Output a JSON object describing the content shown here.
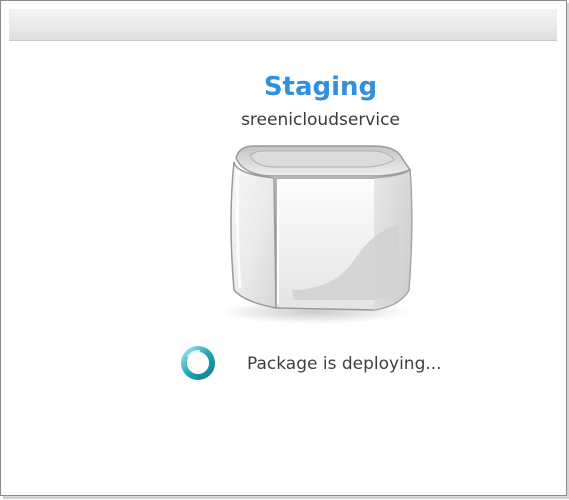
{
  "deployment": {
    "environment": "Staging",
    "service_name": "sreenicloudservice",
    "status_text": "Package is deploying...",
    "cube_icon": "cloud-service-cube-icon",
    "spinner_icon": "loading-spinner-icon"
  },
  "colors": {
    "title": "#2f8fe0",
    "text": "#3f3f3f",
    "spinner": "#1ea7b8"
  }
}
